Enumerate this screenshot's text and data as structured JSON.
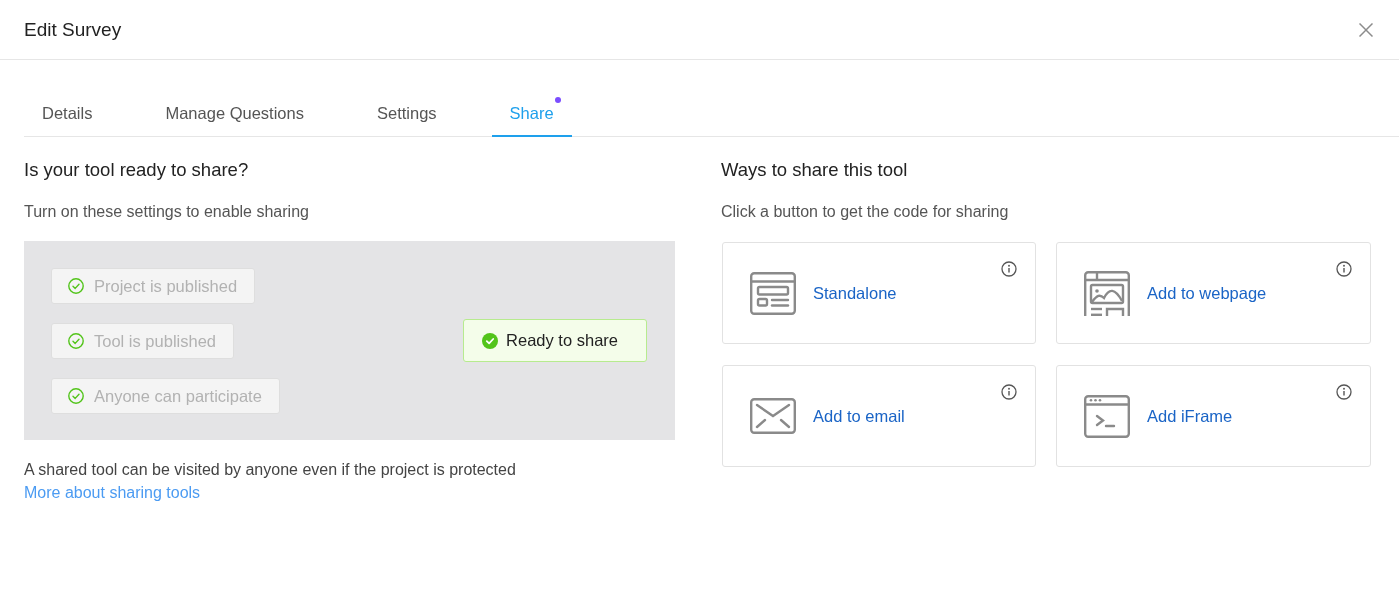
{
  "window": {
    "title": "Edit Survey"
  },
  "tabs": [
    {
      "label": "Details",
      "selected": false,
      "dot": false
    },
    {
      "label": "Manage Questions",
      "selected": false,
      "dot": false
    },
    {
      "label": "Settings",
      "selected": false,
      "dot": false
    },
    {
      "label": "Share",
      "selected": true,
      "dot": true
    }
  ],
  "readiness": {
    "heading": "Is your tool ready to share?",
    "subheading": "Turn on these settings to enable sharing",
    "requirements": [
      {
        "label": "Project is published",
        "checked": true
      },
      {
        "label": "Tool is published",
        "checked": true
      },
      {
        "label": "Anyone can participate",
        "checked": true
      }
    ],
    "status": {
      "label": "Ready to share",
      "ready": true
    },
    "note": "A shared tool can be visited by anyone even if the project is protected",
    "link": "More about sharing tools"
  },
  "share_options": {
    "heading": "Ways to share this tool",
    "subheading": "Click a button to get the code for sharing",
    "options": [
      {
        "kind": "standalone",
        "label": "Standalone"
      },
      {
        "kind": "webpage",
        "label": "Add to webpage"
      },
      {
        "kind": "email",
        "label": "Add to email"
      },
      {
        "kind": "iframe",
        "label": "Add iFrame"
      }
    ]
  }
}
